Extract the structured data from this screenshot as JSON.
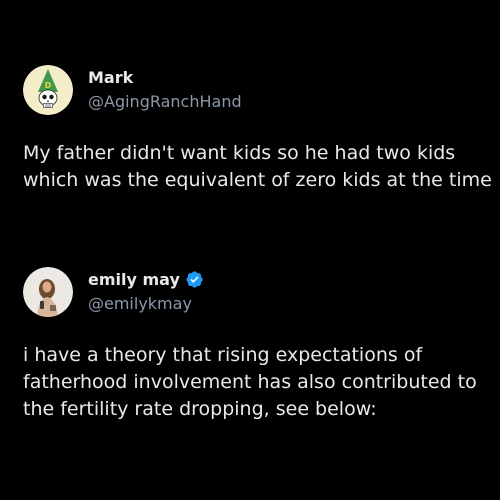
{
  "posts": [
    {
      "display_name": "Mark",
      "handle": "@AgingRanchHand",
      "verified": false,
      "avatar_icon": "skull-dunce-cap-avatar",
      "text": "My father didn't want kids so he had two kids which was the equivalent of zero kids at the time"
    },
    {
      "display_name": "emily may",
      "handle": "@emilykmay",
      "verified": true,
      "avatar_icon": "profile-photo-avatar",
      "text": "i have a theory that rising expectations of fatherhood involvement has also contributed to the fertility rate dropping, see below:"
    }
  ],
  "colors": {
    "background": "#000000",
    "text": "#e7e9ea",
    "secondary_text": "#8b98a5",
    "verified_blue": "#1d9bf0"
  }
}
